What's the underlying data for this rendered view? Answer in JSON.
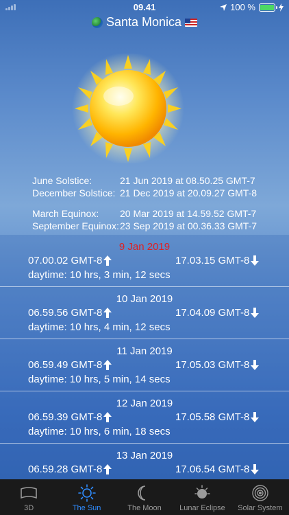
{
  "status": {
    "time": "09.41",
    "battery": "100 %"
  },
  "header": {
    "city": "Santa Monica"
  },
  "events": [
    {
      "label": "June Solstice:",
      "value": "21 Jun 2019 at 08.50.25 GMT-7"
    },
    {
      "label": "December Solstice:",
      "value": "21 Dec 2019 at 20.09.27 GMT-8"
    },
    {
      "label": "March Equinox:",
      "value": "20 Mar 2019 at 14.59.52 GMT-7"
    },
    {
      "label": "September Equinox:",
      "value": "23 Sep 2019 at 00.36.33 GMT-7"
    }
  ],
  "days": [
    {
      "date": "9 Jan 2019",
      "sunrise": "07.00.02 GMT-8",
      "sunset": "17.03.15 GMT-8",
      "daytime": "daytime: 10 hrs, 3 min, 12 secs"
    },
    {
      "date": "10 Jan 2019",
      "sunrise": "06.59.56 GMT-8",
      "sunset": "17.04.09 GMT-8",
      "daytime": "daytime: 10 hrs, 4 min, 12 secs"
    },
    {
      "date": "11 Jan 2019",
      "sunrise": "06.59.49 GMT-8",
      "sunset": "17.05.03 GMT-8",
      "daytime": "daytime: 10 hrs, 5 min, 14 secs"
    },
    {
      "date": "12 Jan 2019",
      "sunrise": "06.59.39 GMT-8",
      "sunset": "17.05.58 GMT-8",
      "daytime": "daytime: 10 hrs, 6 min, 18 secs"
    },
    {
      "date": "13 Jan 2019",
      "sunrise": "06.59.28 GMT-8",
      "sunset": "17.06.54 GMT-8",
      "daytime": ""
    }
  ],
  "tabs": [
    {
      "label": "3D",
      "icon": "3d-icon"
    },
    {
      "label": "The Sun",
      "icon": "sun-icon"
    },
    {
      "label": "The Moon",
      "icon": "moon-icon"
    },
    {
      "label": "Lunar Eclipse",
      "icon": "lunar-eclipse-icon"
    },
    {
      "label": "Solar System",
      "icon": "solar-system-icon"
    }
  ],
  "colors": {
    "accent": "#2f8cff",
    "today": "#e02020",
    "tabbar": "#1a1a1a"
  }
}
